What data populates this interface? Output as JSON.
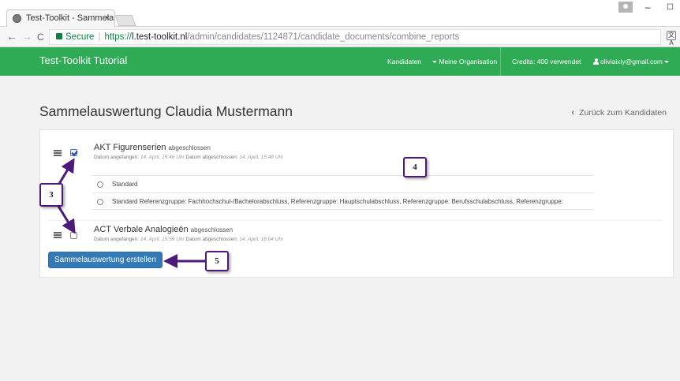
{
  "browser": {
    "tab_title": "Test-Toolkit - Sammelaus",
    "tab_close": "×",
    "window_minimize": "–",
    "window_maximize": "☐",
    "secure_label": "Secure",
    "url_scheme": "https://",
    "url_host": "l.test-toolkit.nl",
    "url_path": "/admin/candidates/1124871/candidate_documents/combine_reports",
    "back_arrow": "←",
    "forward_arrow": "→",
    "reload": "C",
    "translate": "文A"
  },
  "appnav": {
    "brand": "Test-Toolkit Tutorial",
    "candidates": "Kandidaten",
    "organisation": "Meine Organisation",
    "credits": "Credits: 400 verwendet",
    "user_email": "oliviaixly@gmail.com"
  },
  "page": {
    "title": "Sammelauswertung Claudia Mustermann",
    "back_chevron": "‹",
    "back_link": "Zurück zum Kandidaten"
  },
  "tests": [
    {
      "name": "AKT Figurenserien",
      "status": "abgeschlossen",
      "started_label": "Datum angefangen:",
      "started": "14. April, 15:46 Uhr",
      "finished_label": "Datum abgeschlossen:",
      "finished": "14. April, 15:48 Uhr",
      "checked": true
    },
    {
      "name": "ACT Verbale Analogieën",
      "status": "abgeschlossen",
      "started_label": "Datum angefangen:",
      "started": "14. April, 15:59 Uhr",
      "finished_label": "Datum abgeschlossen:",
      "finished": "14. April, 16:04 Uhr",
      "checked": false
    }
  ],
  "norm_options": [
    "Standard",
    "Standard   Referenzgruppe: Fachhochschul-/Bachelorabschluss, Referenzgruppe: Hauptschulabschluss, Referenzgruppe: Berufsschulabschluss, Referenzgruppe:"
  ],
  "submit_button": "Sammelauswertung erstellen",
  "callouts": {
    "c3": "3",
    "c4": "4",
    "c5": "5"
  },
  "colors": {
    "nav_green": "#2eab54",
    "primary_blue": "#337ab7",
    "callout_border": "#4b1a7a"
  }
}
